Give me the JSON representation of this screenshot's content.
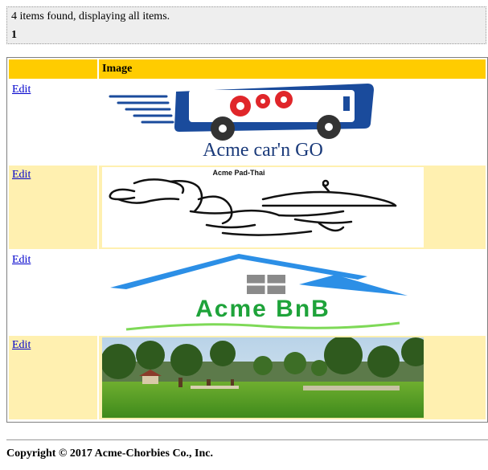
{
  "banner": {
    "found_text": "4 items found, displaying all items.",
    "current_page": "1"
  },
  "table": {
    "columns": [
      "",
      "Image"
    ],
    "rows": [
      {
        "edit_label": "Edit",
        "image": "acme-carngo-logo",
        "logo_text": "Acme car'n GO"
      },
      {
        "edit_label": "Edit",
        "image": "acme-pad-thai-logo",
        "logo_text": "Acme Pad-Thai"
      },
      {
        "edit_label": "Edit",
        "image": "acme-bnb-logo",
        "logo_text": "Acme BnB"
      },
      {
        "edit_label": "Edit",
        "image": "park-photo"
      }
    ]
  },
  "footer": {
    "copyright": "Copyright © 2017 Acme-Chorbies Co., Inc."
  },
  "colors": {
    "header_bg": "#ffcc00",
    "alt_row_bg": "#fff0b0",
    "banner_bg": "#eeeeee",
    "link": "#0000cc"
  }
}
